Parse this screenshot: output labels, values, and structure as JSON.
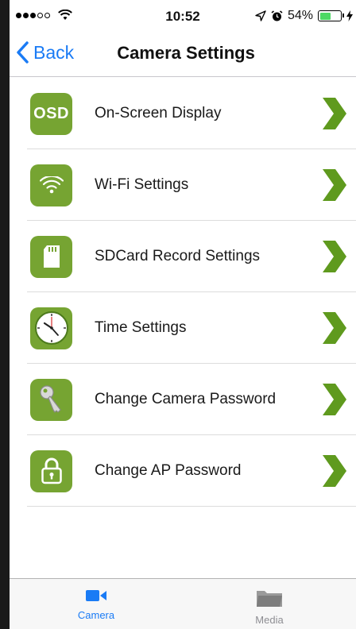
{
  "status_bar": {
    "time": "10:52",
    "battery_percent": "54%",
    "battery_level": 0.54
  },
  "nav": {
    "back_label": "Back",
    "title": "Camera Settings"
  },
  "settings": [
    {
      "label": "On-Screen Display",
      "icon": "osd-icon",
      "icon_text": "OSD"
    },
    {
      "label": "Wi-Fi Settings",
      "icon": "wifi-icon"
    },
    {
      "label": "SDCard Record Settings",
      "icon": "sdcard-icon"
    },
    {
      "label": "Time Settings",
      "icon": "clock-icon"
    },
    {
      "label": "Change Camera Password",
      "icon": "key-icon"
    },
    {
      "label": "Change AP Password",
      "icon": "lock-icon"
    }
  ],
  "tabs": [
    {
      "label": "Camera",
      "icon": "video-camera-icon",
      "active": true
    },
    {
      "label": "Media",
      "icon": "folder-icon",
      "active": false
    }
  ],
  "colors": {
    "accent": "#1a7bf5",
    "icon_green": "#76a432",
    "chevron_green": "#5f9a1e"
  }
}
